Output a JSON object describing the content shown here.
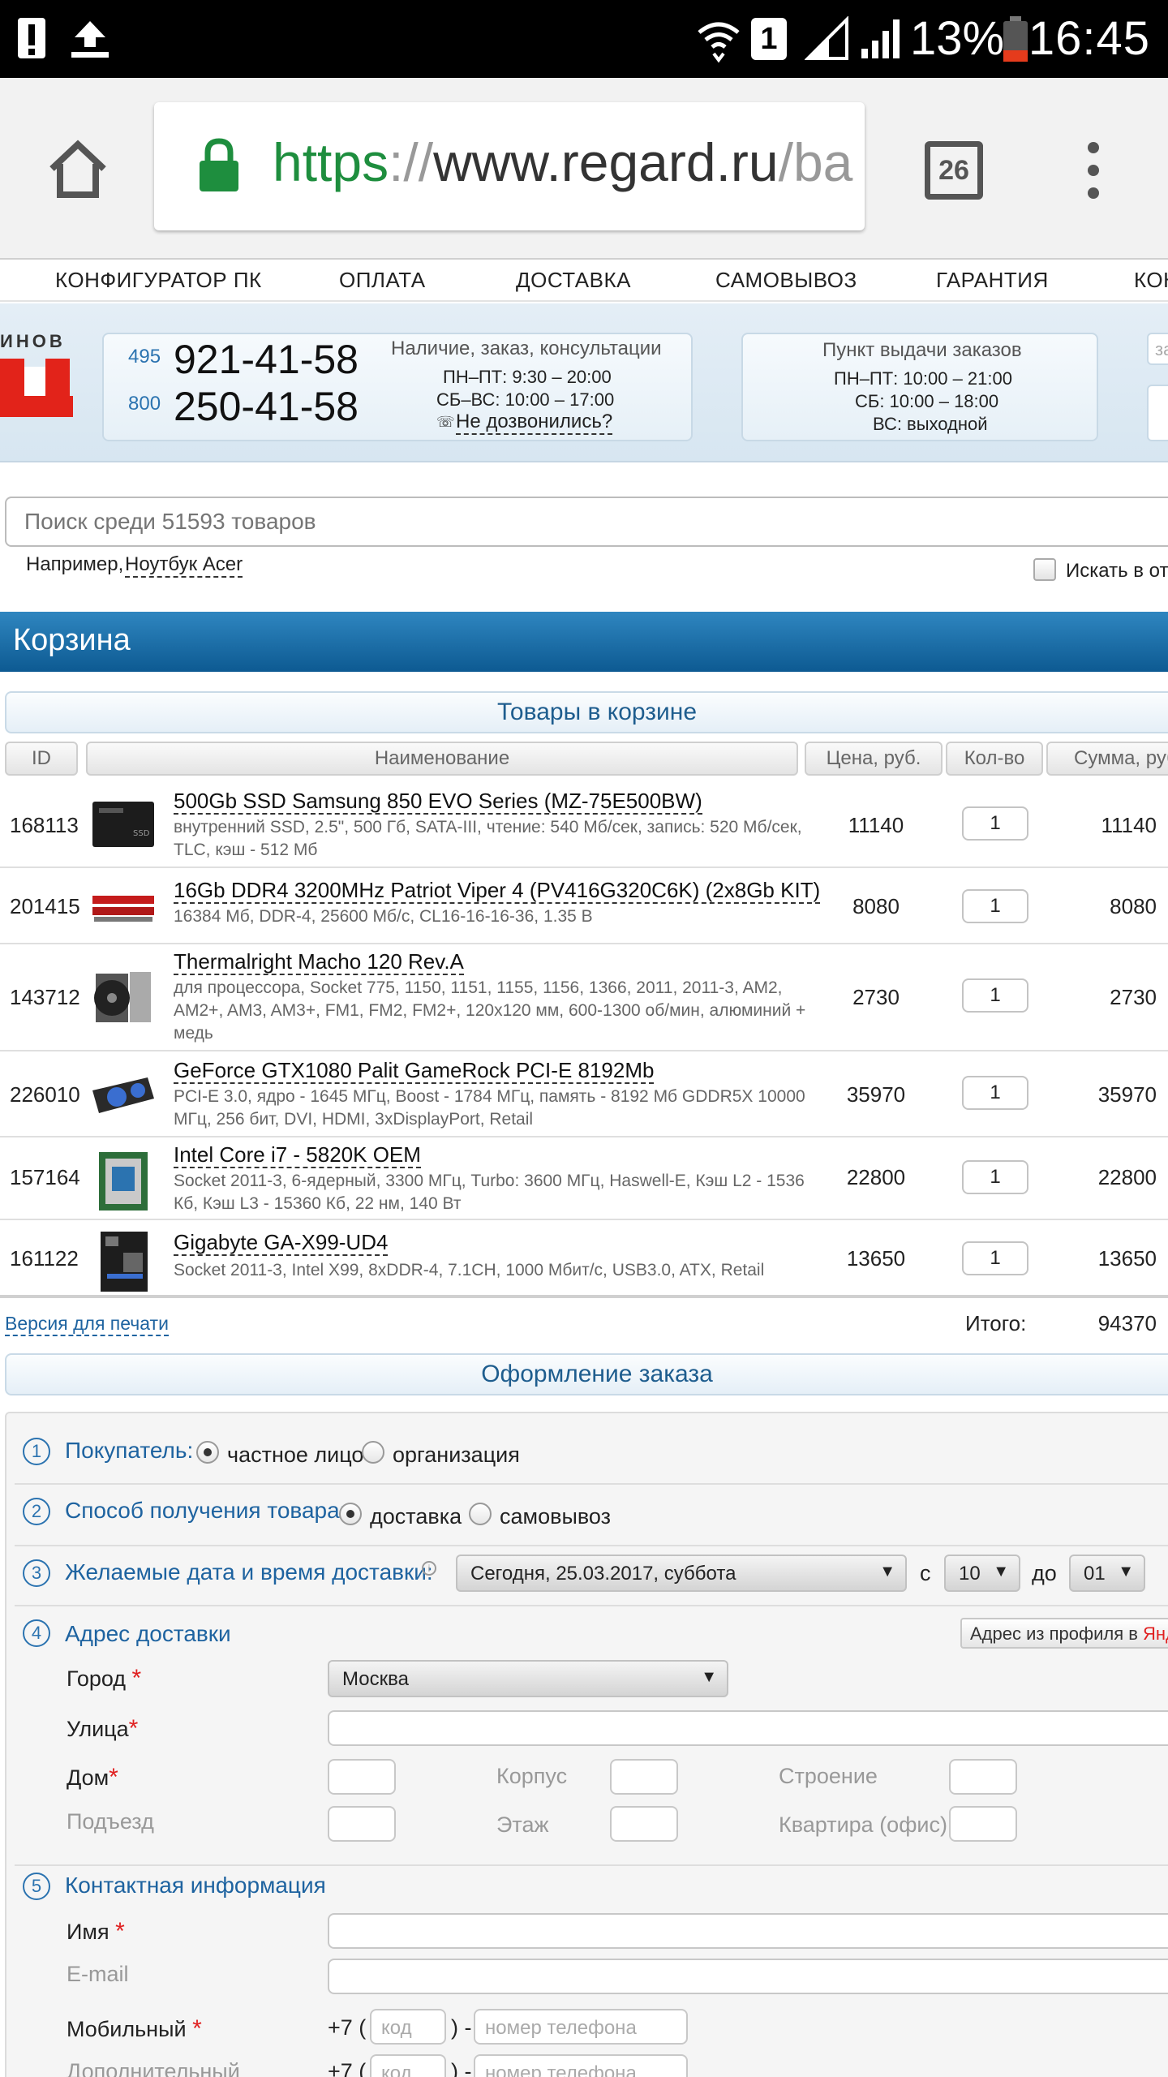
{
  "status_bar": {
    "sim_slot": "1",
    "battery": "13%",
    "time": "16:45"
  },
  "browser": {
    "url_scheme": "https",
    "url_sep": "://",
    "url_host": "www.regard.ru",
    "url_rest": "/ba",
    "tab_count": "26"
  },
  "nav": {
    "items": [
      "КОНФИГУРАТОР ПК",
      "ОПЛАТА",
      "ДОСТАВКА",
      "САМОВЫВОЗ",
      "ГАРАНТИЯ",
      "КОНТ"
    ]
  },
  "header": {
    "logo_text": "ИНОВ",
    "phone1_code": "495",
    "phone1_num": "921-41-58",
    "phone2_code": "800",
    "phone2_num": "250-41-58",
    "info_title": "Наличие, заказ, консультации",
    "info_line1": "ПН–ПТ: 9:30 – 20:00",
    "info_line2": "СБ–ВС: 10:00 – 17:00",
    "callback": "Не дозвонились?",
    "pickup_title": "Пункт выдачи заказов",
    "pickup_line1": "ПН–ПТ: 10:00 – 21:00",
    "pickup_line2": "СБ: 10:00 – 18:00",
    "pickup_line3": "ВС: выходной",
    "side_input": "за"
  },
  "search": {
    "placeholder": "Поиск среди 51593 товаров",
    "example_label": "Например,",
    "example_link": "Ноутбук Acer",
    "checkbox_label": "Искать в от"
  },
  "cart": {
    "title": "Корзина",
    "section_title": "Товары в корзине",
    "columns": [
      "ID",
      "Наименование",
      "Цена, руб.",
      "Кол-во",
      "Сумма, руб"
    ],
    "rows": [
      {
        "id": "168113",
        "name": "500Gb SSD Samsung 850 EVO Series (MZ-75E500BW)",
        "desc": "внутренний SSD, 2.5\", 500 Гб, SATA-III, чтение: 540 Мб/сек, запись: 520 Мб/сек, TLC, кэш - 512 Мб",
        "price": "11140",
        "qty": "1",
        "sum": "11140"
      },
      {
        "id": "201415",
        "name": "16Gb DDR4 3200MHz Patriot Viper 4 (PV416G320C6K) (2x8Gb KIT)",
        "desc": "16384 Мб, DDR-4, 25600 Мб/с, CL16-16-16-36, 1.35 В",
        "price": "8080",
        "qty": "1",
        "sum": "8080"
      },
      {
        "id": "143712",
        "name": "Thermalright Macho 120 Rev.A",
        "desc": "для процессора, Socket 775, 1150, 1151, 1155, 1156, 1366, 2011, 2011-3, AM2, AM2+, AM3, AM3+, FM1, FM2, FM2+, 120x120 мм, 600-1300 об/мин, алюминий + медь",
        "price": "2730",
        "qty": "1",
        "sum": "2730"
      },
      {
        "id": "226010",
        "name": "GeForce GTX1080 Palit GameRock PCI-E 8192Mb",
        "desc": "PCI-E 3.0, ядро - 1645 МГц, Boost - 1784 МГц, память - 8192 Мб GDDR5X 10000 МГц, 256 бит, DVI, HDMI, 3xDisplayPort, Retail",
        "price": "35970",
        "qty": "1",
        "sum": "35970"
      },
      {
        "id": "157164",
        "name": "Intel Core i7 - 5820K OEM",
        "desc": "Socket 2011-3, 6-ядерный, 3300 МГц, Turbo: 3600 МГц, Haswell-E, Кэш L2 - 1536 Кб, Кэш L3 - 15360 Кб, 22 нм, 140 Вт",
        "price": "22800",
        "qty": "1",
        "sum": "22800"
      },
      {
        "id": "161122",
        "name": "Gigabyte GA-X99-UD4",
        "desc": "Socket 2011-3, Intel X99, 8xDDR-4, 7.1CH, 1000 Мбит/с, USB3.0, ATX, Retail",
        "price": "13650",
        "qty": "1",
        "sum": "13650"
      }
    ],
    "print_link": "Версия для печати",
    "total_label": "Итого:",
    "total_value": "94370"
  },
  "order": {
    "section_title": "Оформление заказа",
    "step1": {
      "num": "1",
      "label": "Покупатель:",
      "opt1": "частное лицо",
      "opt2": "организация"
    },
    "step2": {
      "num": "2",
      "label": "Способ получения товара:",
      "opt1": "доставка",
      "opt2": "самовывоз"
    },
    "step3": {
      "num": "3",
      "label": "Желаемые дата и время доставки:",
      "date": "Сегодня, 25.03.2017, суббота",
      "from_label": "с",
      "from": "10",
      "to_label": "до",
      "to": "01"
    },
    "step4": {
      "num": "4",
      "label": "Адрес доставки",
      "profile_btn": "Адрес из профиля в ",
      "profile_brand": "Янд",
      "city_label": "Город",
      "city": "Москва",
      "street_label": "Улица",
      "house_label": "Дом",
      "korpus_label": "Корпус",
      "stroenie_label": "Строение",
      "podezd_label": "Подъезд",
      "etazh_label": "Этаж",
      "kvartira_label": "Квартира (офис)"
    },
    "step5": {
      "num": "5",
      "label": "Контактная информация",
      "name_label": "Имя",
      "email_label": "E-mail",
      "mobile_label": "Мобильный",
      "extra_label": "Дополнительный",
      "prefix": "+7 (",
      "code_placeholder": "код",
      "close_paren": ") -",
      "phone_placeholder": "номер телефона"
    }
  },
  "colors": {
    "accent": "#1e63a0",
    "cart_header": "#0d5a92",
    "required": "#e02020",
    "secure": "#1e8e3e"
  }
}
